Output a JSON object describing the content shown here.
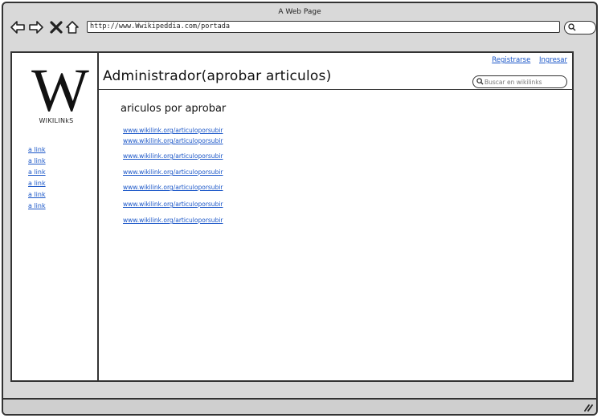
{
  "window": {
    "title": "A Web Page",
    "url": "http://www.Wwikipeddia.com/portada"
  },
  "header": {
    "title": "Administrador(aprobar articulos)",
    "links": [
      "Registrarse",
      "Ingresar"
    ],
    "search_placeholder": "Buscar en wikilinks"
  },
  "logo": {
    "letter": "W",
    "name": "WIKILINkS"
  },
  "sidebar": {
    "links": [
      "a link",
      "a link",
      "a link",
      "a link",
      "a link",
      "a link"
    ]
  },
  "main": {
    "section_title": "ariculos por aprobar",
    "article_links": [
      "www.wikilink.org/articuloporsubir",
      "www.wikilink.org/articuloporsubir",
      "www.wikilink.org/articuloporsubir",
      "www.wikilink.org/articuloporsubir",
      "www.wikilink.org/articuloporsubir",
      "www.wikilink.org/articuloporsubir",
      "www.wikilink.org/articuloporsubir"
    ]
  },
  "colors": {
    "link": "#1a56c8",
    "chrome": "#d9d9d9",
    "border": "#333333"
  }
}
